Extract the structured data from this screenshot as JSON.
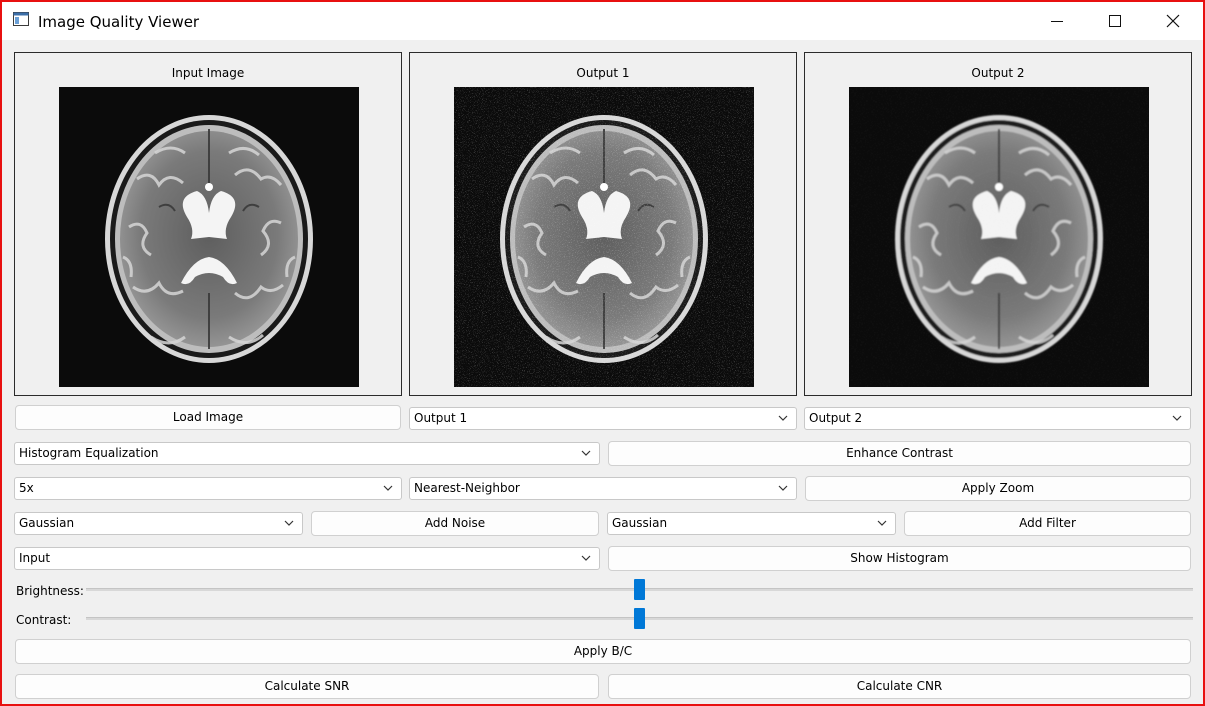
{
  "window": {
    "title": "Image Quality Viewer",
    "border_color": "#e81010"
  },
  "panels": {
    "input": {
      "title": "Input Image"
    },
    "output1": {
      "title": "Output 1"
    },
    "output2": {
      "title": "Output 2"
    }
  },
  "controls": {
    "load_image": "Load Image",
    "output1_select": "Output 1",
    "output2_select": "Output 2",
    "enhancement_method": "Histogram Equalization",
    "enhance_contrast": "Enhance Contrast",
    "zoom_factor": "5x",
    "interpolation_method": "Nearest-Neighbor",
    "apply_zoom": "Apply Zoom",
    "noise_type": "Gaussian",
    "add_noise": "Add Noise",
    "filter_type": "Gaussian",
    "add_filter": "Add Filter",
    "histogram_source": "Input",
    "show_histogram": "Show Histogram",
    "brightness_label": "Brightness:",
    "contrast_label": "Contrast:",
    "apply_bc": "Apply B/C",
    "calculate_snr": "Calculate SNR",
    "calculate_cnr": "Calculate CNR"
  },
  "sliders": {
    "brightness_level": 0.5,
    "contrast_level": 0.5
  },
  "icons": {
    "app": "app-window-icon",
    "minimize": "minimize-icon",
    "maximize": "maximize-icon",
    "close": "close-icon",
    "dropdown": "chevron-down-icon"
  },
  "colors": {
    "accent": "#0078d7",
    "window_bg": "#f0f0f0"
  }
}
